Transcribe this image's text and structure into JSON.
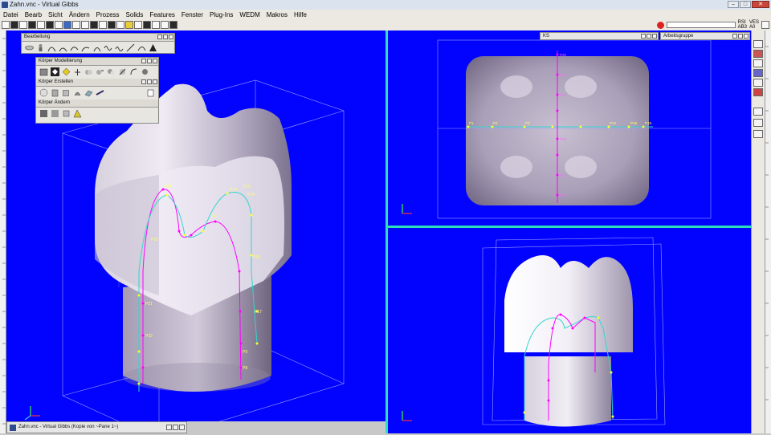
{
  "window": {
    "title": "Zahn.vnc - Virtual Gibbs",
    "controls": [
      "–",
      "□",
      "✕"
    ]
  },
  "menu": [
    "Datei",
    "Bearb",
    "Sicht",
    "Ändern",
    "Prozess",
    "Solids",
    "Features",
    "Fenster",
    "Plug-Ins",
    "WEDM",
    "Makros",
    "Hilfe"
  ],
  "toolbar_right": {
    "labels_top": [
      "RSI",
      "VES"
    ],
    "labels_bottom": [
      "AB3",
      "A0"
    ]
  },
  "panels": {
    "bearbeitung": {
      "title": "Bearbeitung"
    },
    "modellierung": {
      "title": "Körper Modellierung"
    },
    "erstellen": {
      "title": "Körper Erstellen"
    },
    "aendern": {
      "title": "Körper Ändern"
    }
  },
  "viewports": {
    "top_right_tab": "KS",
    "top_right_tab2": "Arbeitsgruppe",
    "left_points": [
      "P24",
      "P13",
      "P14",
      "P15",
      "P11",
      "P16",
      "P17",
      "P18",
      "P19",
      "P10",
      "P9",
      "P8",
      "P7",
      "P6",
      "P5",
      "P4",
      "P3",
      "P2",
      "P20",
      "P21",
      "P22",
      "P23"
    ],
    "tr_points": [
      "P1",
      "P2",
      "P3",
      "P4",
      "P5",
      "P6",
      "P7",
      "P8",
      "P9",
      "P10",
      "P11",
      "P12",
      "P13",
      "P14",
      "P15",
      "P16",
      "P17",
      "P18",
      "P19",
      "P20",
      "P21",
      "P22",
      "P23",
      "P24",
      "P25"
    ]
  },
  "taskbar": {
    "label": "Zahn.vnc - Virtual Gibbs (Kopie von ~Pane 1~)"
  },
  "colors": {
    "viewport_bg": "#0202ff",
    "separator": "#2be0b8",
    "solid": "#bbb3c8",
    "spline_magenta": "#ff00ff",
    "spline_cyan": "#33d6cc",
    "point_yellow": "#ffff33"
  }
}
